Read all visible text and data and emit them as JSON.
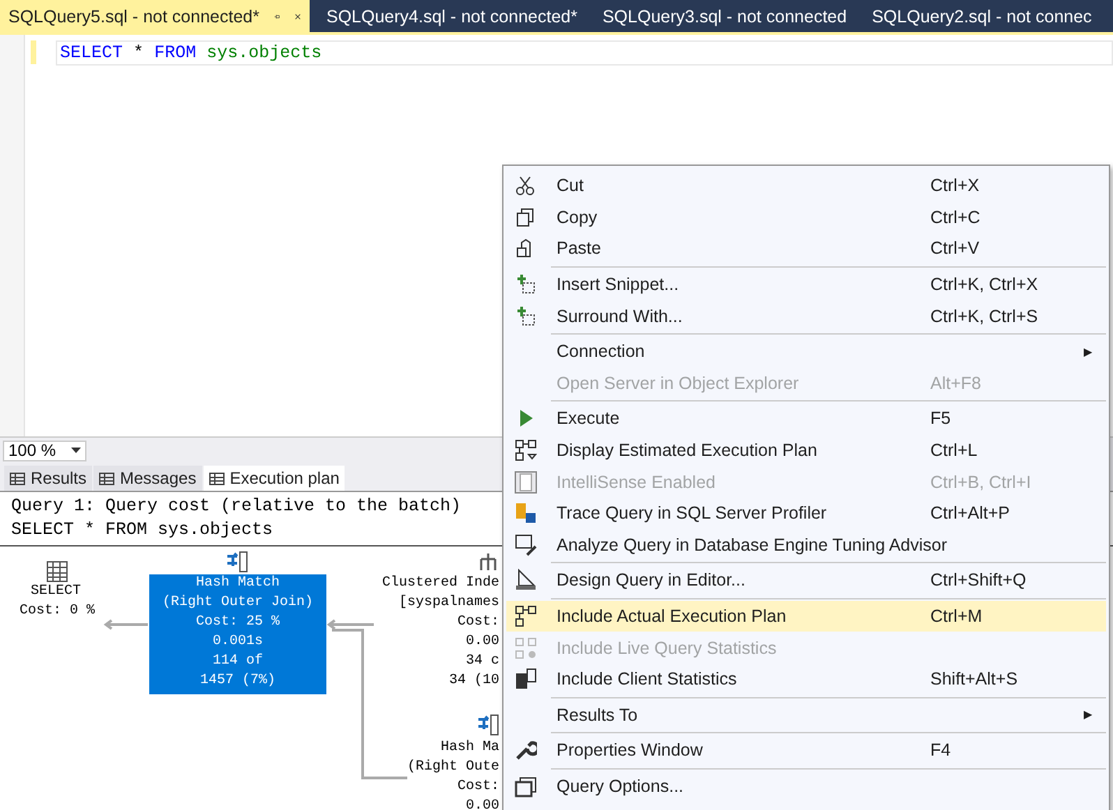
{
  "doc_tabs": [
    {
      "title": "SQLQuery5.sql - not connected*",
      "selected": true
    },
    {
      "title": "SQLQuery4.sql - not connected*",
      "selected": false
    },
    {
      "title": "SQLQuery3.sql - not connected",
      "selected": false
    },
    {
      "title": "SQLQuery2.sql - not connec",
      "selected": false
    }
  ],
  "editor": {
    "lines": [
      {
        "keyword1": "SELECT",
        "operator": "*",
        "keyword2": "FROM",
        "object": "sys.objects"
      }
    ]
  },
  "results": {
    "zoom": "100 %",
    "tabs": [
      {
        "label": "Results",
        "selected": false
      },
      {
        "label": "Messages",
        "selected": false
      },
      {
        "label": "Execution plan",
        "selected": true
      }
    ],
    "header": [
      "Query 1: Query cost (relative to the batch)",
      "SELECT * FROM sys.objects"
    ],
    "nodes": [
      {
        "kind": "select",
        "lines": [
          "SELECT",
          "Cost: 0 %"
        ],
        "selected": false
      },
      {
        "kind": "hash",
        "lines": [
          "Hash Match",
          "(Right Outer Join)",
          "Cost: 25 %",
          "0.001s",
          "114 of",
          "1457 (7%)"
        ],
        "selected": true
      },
      {
        "kind": "index",
        "lines": [
          "Clustered Inde",
          "[syspalnames",
          "Cost:",
          "0.00",
          "34 c",
          "34 (10"
        ],
        "selected": false
      },
      {
        "kind": "hash",
        "lines": [
          "Hash Ma",
          "(Right Oute",
          "Cost:",
          "0.00"
        ],
        "selected": false
      }
    ]
  },
  "context_menu": [
    {
      "kind": "item",
      "label": "Cut",
      "shortcut": "Ctrl+X",
      "disabled": false,
      "selected": false
    },
    {
      "kind": "item",
      "label": "Copy",
      "shortcut": "Ctrl+C",
      "disabled": false,
      "selected": false
    },
    {
      "kind": "item",
      "label": "Paste",
      "shortcut": "Ctrl+V",
      "disabled": false,
      "selected": false
    },
    {
      "kind": "separator"
    },
    {
      "kind": "item",
      "label": "Insert Snippet...",
      "shortcut": "Ctrl+K, Ctrl+X",
      "disabled": false,
      "selected": false
    },
    {
      "kind": "item",
      "label": "Surround With...",
      "shortcut": "Ctrl+K, Ctrl+S",
      "disabled": false,
      "selected": false
    },
    {
      "kind": "separator"
    },
    {
      "kind": "submenu",
      "label": "Connection",
      "arrow": "▶",
      "disabled": false,
      "selected": false
    },
    {
      "kind": "item",
      "label": "Open Server in Object Explorer",
      "shortcut": "Alt+F8",
      "disabled": true,
      "selected": false
    },
    {
      "kind": "separator"
    },
    {
      "kind": "item",
      "label": "Execute",
      "shortcut": "F5",
      "disabled": false,
      "selected": false
    },
    {
      "kind": "item",
      "label": "Display Estimated Execution Plan",
      "shortcut": "Ctrl+L",
      "disabled": false,
      "selected": false
    },
    {
      "kind": "item",
      "label": "IntelliSense Enabled",
      "shortcut": "Ctrl+B, Ctrl+I",
      "disabled": true,
      "selected": false
    },
    {
      "kind": "item",
      "label": "Trace Query in SQL Server Profiler",
      "shortcut": "Ctrl+Alt+P",
      "disabled": false,
      "selected": false
    },
    {
      "kind": "item",
      "label": "Analyze Query in Database Engine Tuning Advisor",
      "disabled": false,
      "selected": false
    },
    {
      "kind": "separator"
    },
    {
      "kind": "item",
      "label": "Design Query in Editor...",
      "shortcut": "Ctrl+Shift+Q",
      "disabled": false,
      "selected": false
    },
    {
      "kind": "separator"
    },
    {
      "kind": "item",
      "label": "Include Actual Execution Plan",
      "shortcut": "Ctrl+M",
      "disabled": false,
      "selected": true
    },
    {
      "kind": "item",
      "label": "Include Live Query Statistics",
      "disabled": true,
      "selected": false
    },
    {
      "kind": "item",
      "label": "Include Client Statistics",
      "shortcut": "Shift+Alt+S",
      "disabled": false,
      "selected": false
    },
    {
      "kind": "separator"
    },
    {
      "kind": "submenu",
      "label": "Results To",
      "arrow": "▶",
      "disabled": false,
      "selected": false
    },
    {
      "kind": "separator"
    },
    {
      "kind": "item",
      "label": "Properties Window",
      "shortcut": "F4",
      "disabled": false,
      "selected": false
    },
    {
      "kind": "separator"
    },
    {
      "kind": "item",
      "label": "Query Options...",
      "disabled": false,
      "selected": false
    }
  ]
}
